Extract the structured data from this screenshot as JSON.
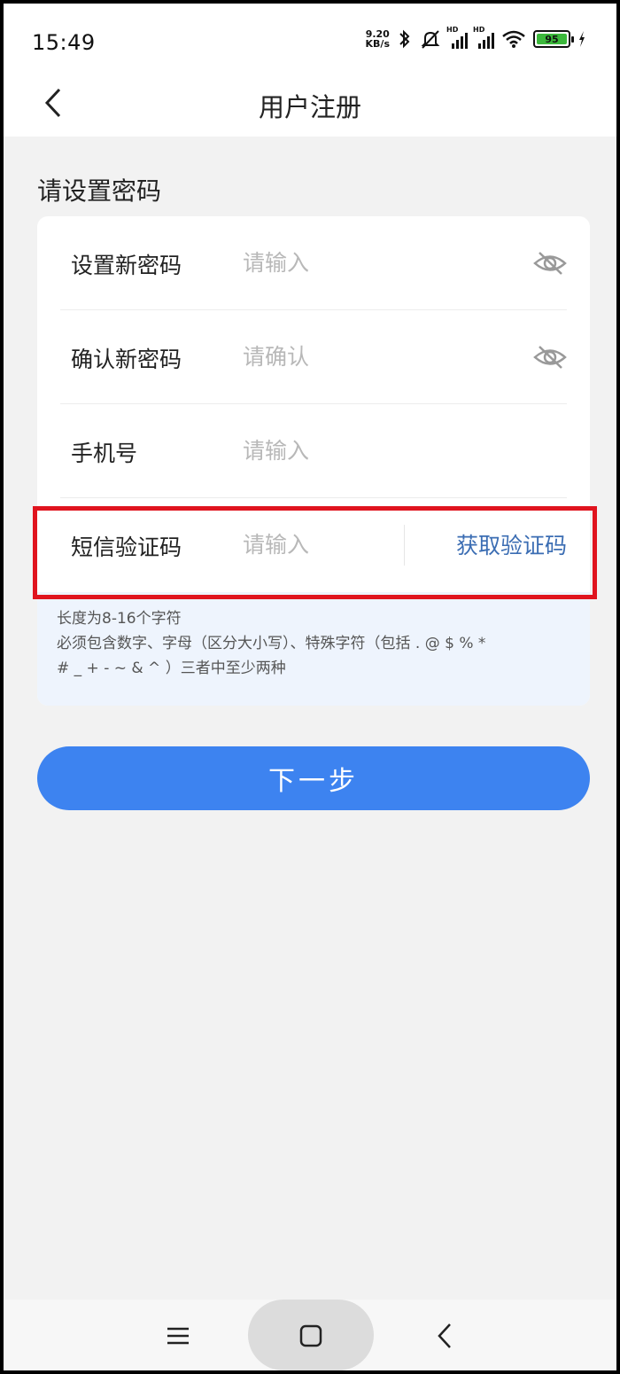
{
  "status_bar": {
    "time": "15:49",
    "net_speed_value": "9.20",
    "net_speed_unit": "KB/s",
    "battery": "95"
  },
  "header": {
    "title": "用户注册"
  },
  "section_title": "请设置密码",
  "form": {
    "new_password": {
      "label": "设置新密码",
      "placeholder": "请输入"
    },
    "confirm_password": {
      "label": "确认新密码",
      "placeholder": "请确认"
    },
    "phone": {
      "label": "手机号",
      "placeholder": "请输入"
    },
    "sms_code": {
      "label": "短信验证码",
      "placeholder": "请输入",
      "get_code": "获取验证码"
    }
  },
  "hint": {
    "line1": "长度为8-16个字符",
    "line2": "必须包含数字、字母（区分大小写）、特殊字符（包括 . @ $ % *",
    "line3": "# _ + - ~ & ^ ）三者中至少两种"
  },
  "next_button": "下一步",
  "colors": {
    "accent": "#3d83f0",
    "link": "#3b6db3",
    "highlight_border": "#e0141e",
    "hint_bg": "#eef4fd"
  },
  "icons": {
    "back": "chevron-left-icon",
    "eye_hidden": "eye-off-icon",
    "nav_menu": "menu-icon",
    "nav_home": "home-square-icon",
    "nav_back": "chevron-left-icon"
  }
}
